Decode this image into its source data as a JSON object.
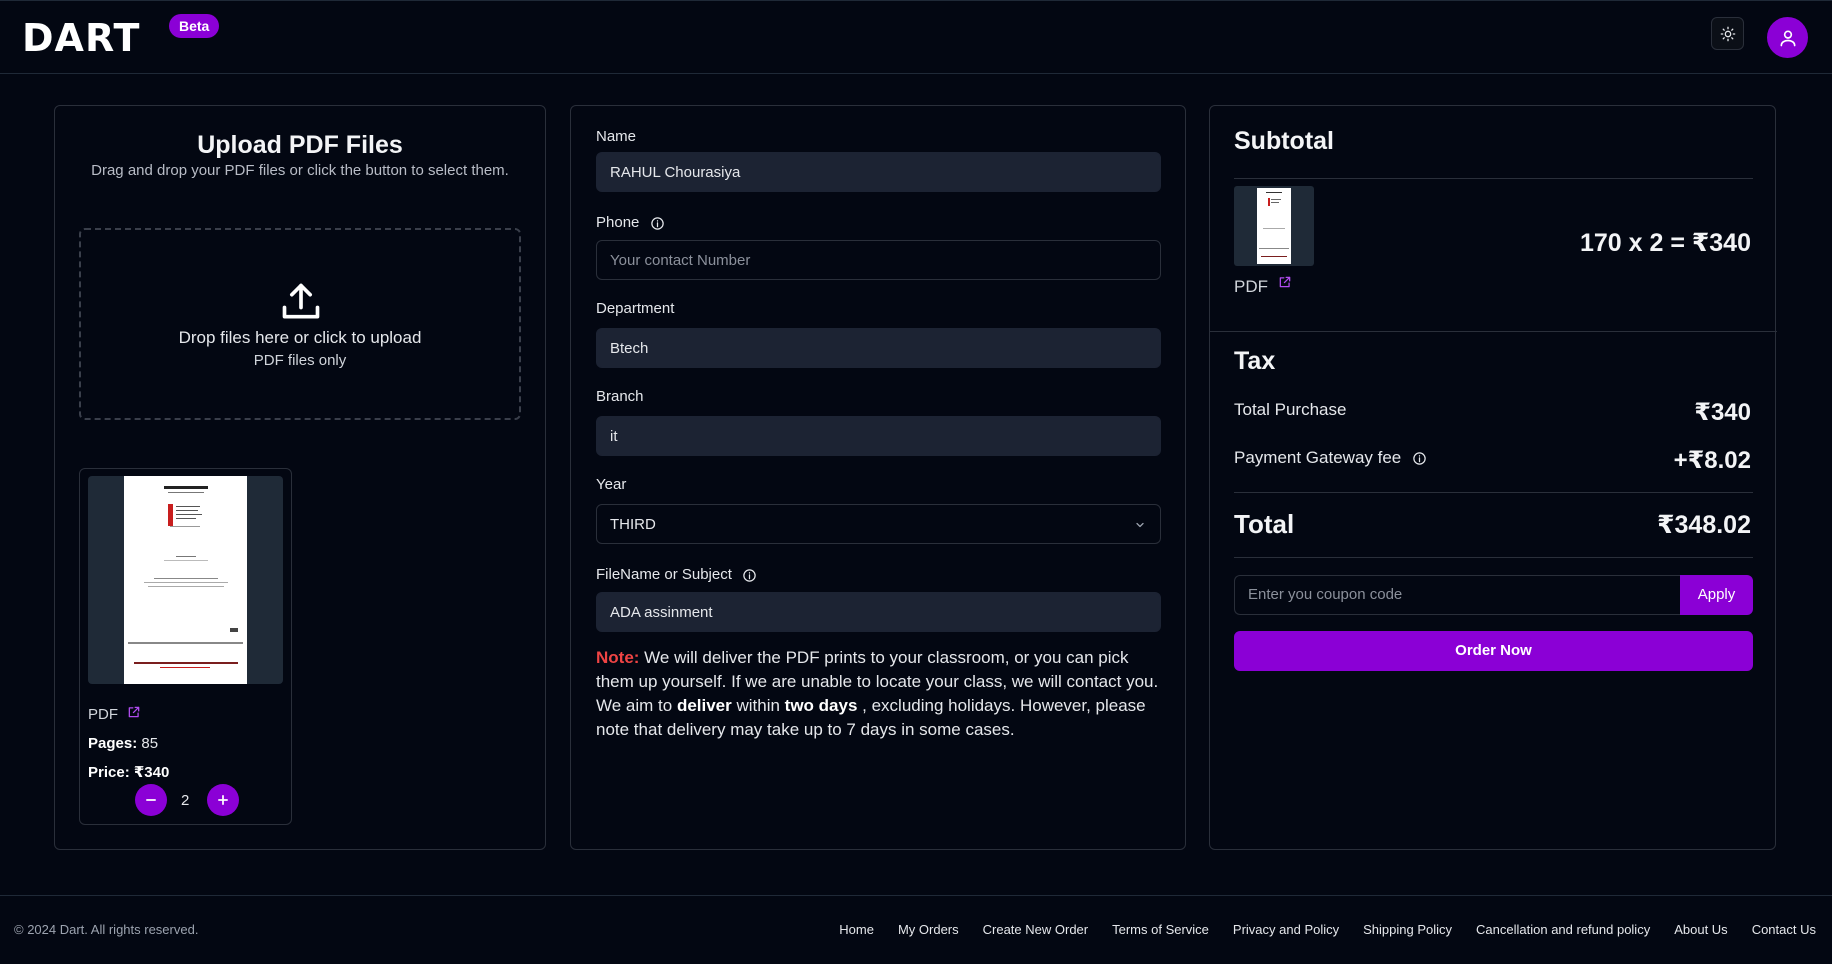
{
  "header": {
    "logo": "DART",
    "badge": "Beta"
  },
  "upload": {
    "title": "Upload PDF Files",
    "subtitle": "Drag and drop your PDF files or click the button to select them.",
    "drop_main": "Drop files here or click to upload",
    "drop_sub": "PDF files only",
    "file": {
      "type_label": "PDF",
      "pages_label": "Pages:",
      "pages_value": "85",
      "price_label": "Price:",
      "price_value": "₹340",
      "quantity": "2"
    }
  },
  "form": {
    "name_label": "Name",
    "name_value": "RAHUL Chourasiya",
    "phone_label": "Phone",
    "phone_placeholder": "Your contact Number",
    "department_label": "Department",
    "department_value": "Btech",
    "branch_label": "Branch",
    "branch_value": "it",
    "year_label": "Year",
    "year_value": "THIRD",
    "filename_label": "FileName or Subject",
    "filename_value": "ADA assinment",
    "note": {
      "label": "Note:",
      "text1": " We will deliver the PDF prints to your classroom, or you can pick them up yourself. If we are unable to locate your class, we will contact you. We aim to ",
      "bold1": "deliver",
      "text2": " within ",
      "bold2": "two days",
      "text3": " , excluding holidays. However, please note that delivery may take up to 7 days in some cases."
    }
  },
  "summary": {
    "subtotal_title": "Subtotal",
    "item_type": "PDF",
    "item_calc": "170 x 2 = ₹340",
    "tax_title": "Tax",
    "total_purchase_label": "Total Purchase",
    "total_purchase_value": "₹340",
    "gateway_fee_label": "Payment Gateway fee",
    "gateway_fee_value": "+₹8.02",
    "total_label": "Total",
    "total_value": "₹348.02",
    "coupon_placeholder": "Enter you coupon code",
    "apply_label": "Apply",
    "order_label": "Order Now"
  },
  "footer": {
    "copyright": "© 2024 Dart. All rights reserved.",
    "links": [
      "Home",
      "My Orders",
      "Create New Order",
      "Terms of Service",
      "Privacy and Policy",
      "Shipping Policy",
      "Cancellation and refund policy",
      "About Us",
      "Contact Us"
    ]
  },
  "colors": {
    "background": "#030712",
    "accent": "#8b00d6",
    "input_fill": "#1c2333",
    "note_red": "#ef4444"
  }
}
